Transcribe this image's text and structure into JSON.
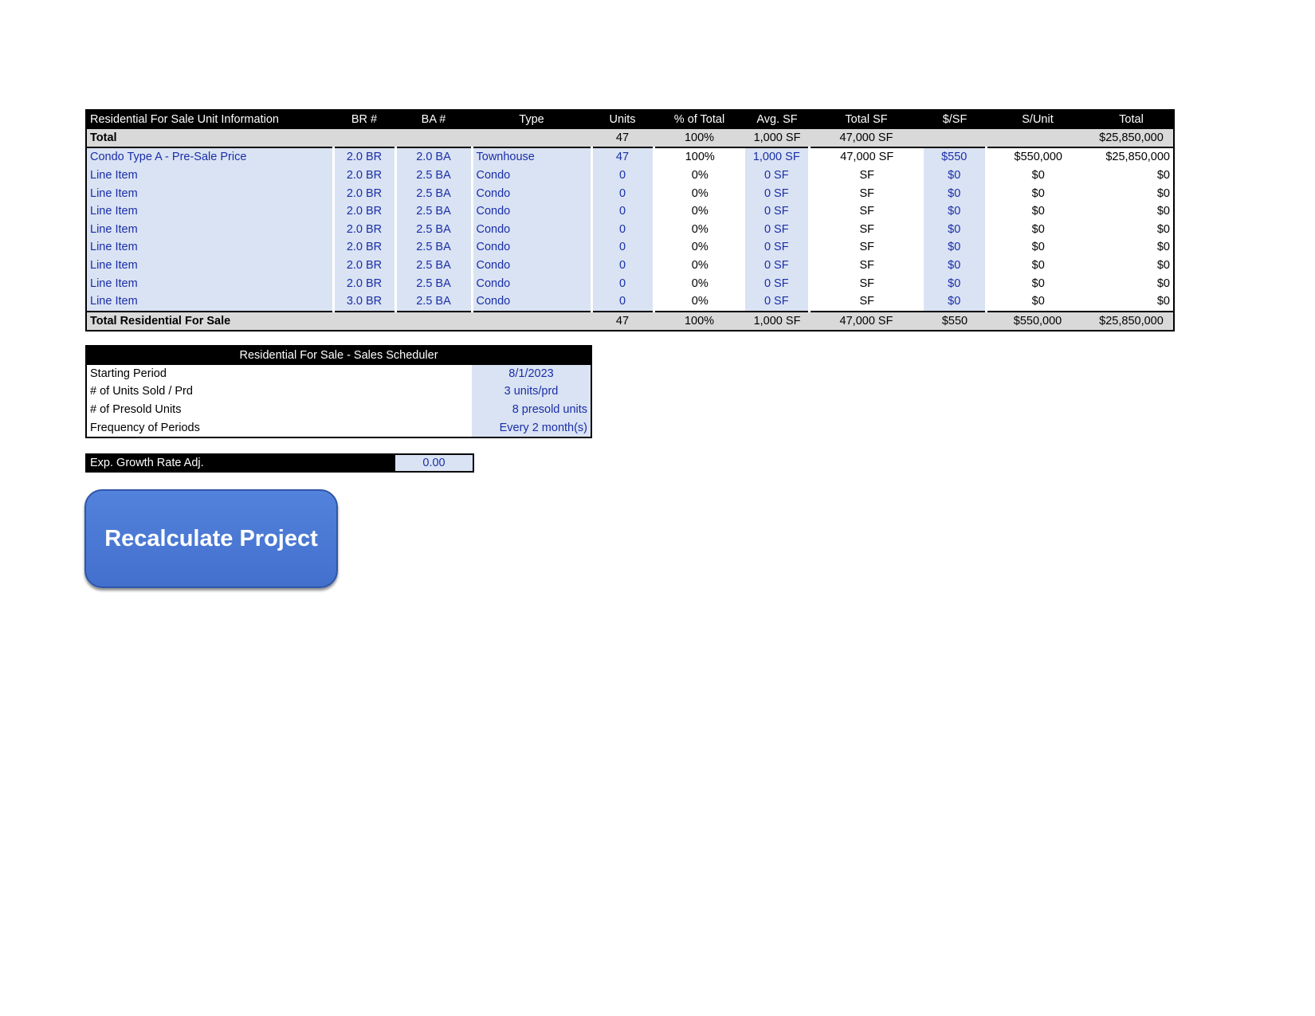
{
  "unit_table": {
    "headers": [
      "Residential For Sale Unit Information",
      "BR #",
      "BA #",
      "Type",
      "Units",
      "% of Total",
      "Avg. SF",
      "Total SF",
      "$/SF",
      "S/Unit",
      "Total"
    ],
    "total_row": {
      "label": "Total",
      "units": "47",
      "pct": "100%",
      "avg_sf": "1,000 SF",
      "total_sf": "47,000 SF",
      "total": "$25,850,000"
    },
    "rows": [
      {
        "name": "Condo Type A - Pre-Sale Price",
        "br": "2.0 BR",
        "ba": "2.0 BA",
        "type": "Townhouse",
        "units": "47",
        "pct": "100%",
        "avg_sf": "1,000 SF",
        "total_sf": "47,000 SF",
        "psf": "$550",
        "per_unit": "$550,000",
        "total": "$25,850,000"
      },
      {
        "name": "Line Item",
        "br": "2.0 BR",
        "ba": "2.5 BA",
        "type": "Condo",
        "units": "0",
        "pct": "0%",
        "avg_sf": "0 SF",
        "total_sf": "SF",
        "psf": "$0",
        "per_unit": "$0",
        "total": "$0"
      },
      {
        "name": "Line Item",
        "br": "2.0 BR",
        "ba": "2.5 BA",
        "type": "Condo",
        "units": "0",
        "pct": "0%",
        "avg_sf": "0 SF",
        "total_sf": "SF",
        "psf": "$0",
        "per_unit": "$0",
        "total": "$0"
      },
      {
        "name": "Line Item",
        "br": "2.0 BR",
        "ba": "2.5 BA",
        "type": "Condo",
        "units": "0",
        "pct": "0%",
        "avg_sf": "0 SF",
        "total_sf": "SF",
        "psf": "$0",
        "per_unit": "$0",
        "total": "$0"
      },
      {
        "name": "Line Item",
        "br": "2.0 BR",
        "ba": "2.5 BA",
        "type": "Condo",
        "units": "0",
        "pct": "0%",
        "avg_sf": "0 SF",
        "total_sf": "SF",
        "psf": "$0",
        "per_unit": "$0",
        "total": "$0"
      },
      {
        "name": "Line Item",
        "br": "2.0 BR",
        "ba": "2.5 BA",
        "type": "Condo",
        "units": "0",
        "pct": "0%",
        "avg_sf": "0 SF",
        "total_sf": "SF",
        "psf": "$0",
        "per_unit": "$0",
        "total": "$0"
      },
      {
        "name": "Line Item",
        "br": "2.0 BR",
        "ba": "2.5 BA",
        "type": "Condo",
        "units": "0",
        "pct": "0%",
        "avg_sf": "0 SF",
        "total_sf": "SF",
        "psf": "$0",
        "per_unit": "$0",
        "total": "$0"
      },
      {
        "name": "Line Item",
        "br": "2.0 BR",
        "ba": "2.5 BA",
        "type": "Condo",
        "units": "0",
        "pct": "0%",
        "avg_sf": "0 SF",
        "total_sf": "SF",
        "psf": "$0",
        "per_unit": "$0",
        "total": "$0"
      },
      {
        "name": "Line Item",
        "br": "3.0 BR",
        "ba": "2.5 BA",
        "type": "Condo",
        "units": "0",
        "pct": "0%",
        "avg_sf": "0 SF",
        "total_sf": "SF",
        "psf": "$0",
        "per_unit": "$0",
        "total": "$0"
      }
    ],
    "grand_total": {
      "label": "Total Residential For Sale",
      "units": "47",
      "pct": "100%",
      "avg_sf": "1,000 SF",
      "total_sf": "47,000 SF",
      "psf": "$550",
      "per_unit": "$550,000",
      "total": "$25,850,000"
    }
  },
  "scheduler": {
    "title": "Residential For Sale - Sales Scheduler",
    "rows": [
      {
        "label": "Starting Period",
        "value": "8/1/2023",
        "align": "c"
      },
      {
        "label": "# of Units Sold / Prd",
        "value": "3 units/prd",
        "align": "c"
      },
      {
        "label": "# of Presold Units",
        "value": "8 presold units",
        "align": "r"
      },
      {
        "label": "Frequency of Periods",
        "value": "Every 2 month(s)",
        "align": "r"
      }
    ]
  },
  "growth": {
    "label": "Exp. Growth Rate Adj.",
    "value": "0.00"
  },
  "button": {
    "label": "Recalculate Project"
  },
  "colors": {
    "input_fill": "#dae3f3",
    "input_text": "#1a2ea8",
    "header_fill": "#000000",
    "total_fill": "#d9d9d9",
    "button_fill": "#4a79d6"
  }
}
